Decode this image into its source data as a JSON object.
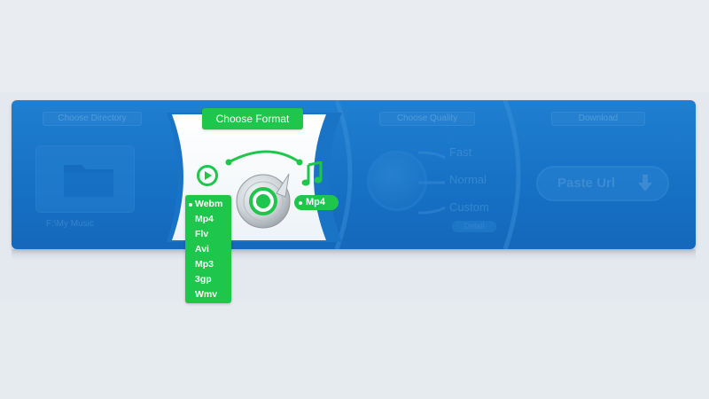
{
  "panels": {
    "folder": {
      "tab_label": "Choose Directory",
      "path_label": "F:\\My Music"
    },
    "format": {
      "tab_label": "Choose Format",
      "formats": [
        "Webm",
        "Mp4",
        "Flv",
        "Avi",
        "Mp3",
        "3gp",
        "Wmv"
      ],
      "highlighted_format": "Webm",
      "selected_format": "Mp4"
    },
    "quality": {
      "tab_label": "Choose Quality",
      "options": [
        "Fast",
        "Normal",
        "Custom"
      ],
      "small_button": "Detail"
    },
    "download": {
      "tab_label": "Download",
      "paste_button": "Paste Url"
    }
  },
  "colors": {
    "accent_green": "#1ec64b",
    "bar_blue": "#1670c4",
    "background": "#e4e9ef"
  },
  "icons": [
    "folder-icon",
    "play-icon",
    "music-note-icon",
    "disc-icon",
    "magnifier-icon",
    "download-arrow-icon"
  ]
}
